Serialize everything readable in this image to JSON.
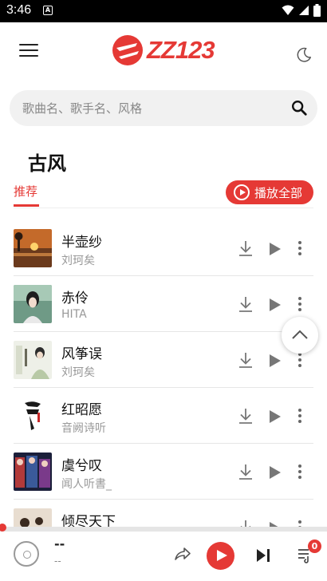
{
  "status_bar": {
    "time": "3:46",
    "notification_icon": "A"
  },
  "header": {
    "logo_text": "ZZ123",
    "menu_icon": "menu-icon",
    "theme_icon": "moon-icon"
  },
  "search": {
    "placeholder": "歌曲名、歌手名、风格",
    "value": ""
  },
  "page_title": "古风",
  "tabs": [
    {
      "label": "推荐",
      "active": true
    }
  ],
  "play_all_label": "播放全部",
  "songs": [
    {
      "title": "半壶纱",
      "artist": "刘珂矣"
    },
    {
      "title": "赤伶",
      "artist": "HITA"
    },
    {
      "title": "风筝误",
      "artist": "刘珂矣"
    },
    {
      "title": "红昭愿",
      "artist": "音阙诗听"
    },
    {
      "title": "虞兮叹",
      "artist": "闻人听書_"
    },
    {
      "title": "倾尽天下",
      "artist": ""
    }
  ],
  "player": {
    "title": "--",
    "artist": "--",
    "queue_count": "0",
    "progress": 0
  },
  "colors": {
    "accent": "#e53935",
    "background": "#ffffff",
    "search_bg": "#f1f1f1",
    "muted_text": "#999999"
  }
}
